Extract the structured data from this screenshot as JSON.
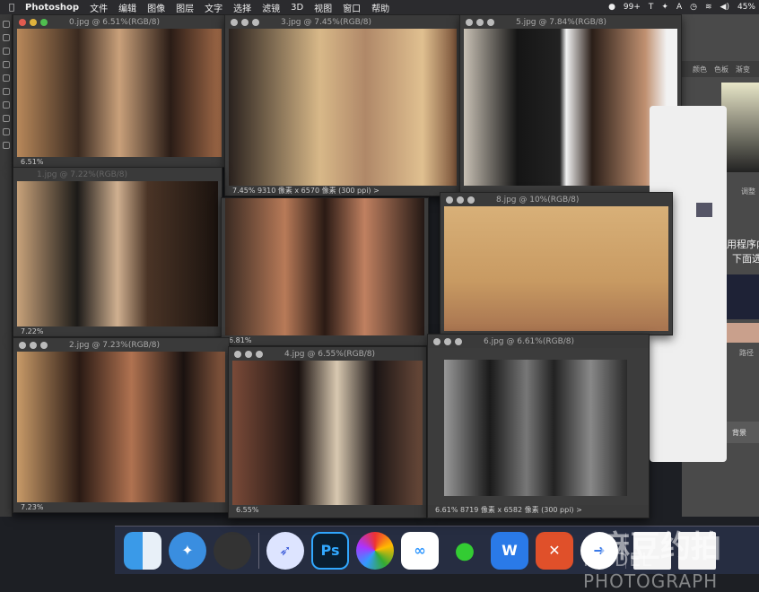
{
  "menubar": {
    "app": "Photoshop",
    "items": [
      "文件",
      "编辑",
      "图像",
      "图层",
      "文字",
      "选择",
      "滤镜",
      "3D",
      "视图",
      "窗口",
      "帮助"
    ],
    "status": {
      "wechat_badge": "99+",
      "battery": "45%"
    }
  },
  "windows": [
    {
      "title": "0.jpg @ 6.51%(RGB/8)",
      "status": "6.51%"
    },
    {
      "title": "3.jpg @ 7.45%(RGB/8)",
      "status": "7.45%    9310 像素 x 6570 像素 (300 ppi)  >"
    },
    {
      "title": "5.jpg @ 7.84%(RGB/8)",
      "status": ""
    },
    {
      "title": "1.jpg @ 7.22%(RGB/8)",
      "status": "7.22%"
    },
    {
      "title": "",
      "status": "6.81%"
    },
    {
      "title": "8.jpg @ 10%(RGB/8)",
      "status": ""
    },
    {
      "title": "2.jpg @ 7.23%(RGB/8)",
      "status": "7.23%"
    },
    {
      "title": "4.jpg @ 6.55%(RGB/8)",
      "status": "6.55%"
    },
    {
      "title": "6.jpg @ 6.61%(RGB/8)",
      "status": "6.61%    8719 像素 x 6582 像素 (300 ppi)  >"
    }
  ],
  "panel": {
    "tabs": [
      "颜色",
      "色板",
      "渐变"
    ],
    "adjust": "调整",
    "text1": "用程序内",
    "text2": "下面选",
    "paths": "路径",
    "layer": "背景"
  },
  "dock": {
    "apps": [
      "Finder",
      "Safari",
      "Photo Booth",
      "Feishu",
      "Ps",
      "Chrome",
      "Baidu",
      "WeChat",
      "WPS",
      "XMind",
      "Migration"
    ],
    "ps_label": "Ps"
  },
  "watermark": {
    "cn": "麻豆约拍",
    "en": "MODEL PHOTOGRAPH"
  }
}
